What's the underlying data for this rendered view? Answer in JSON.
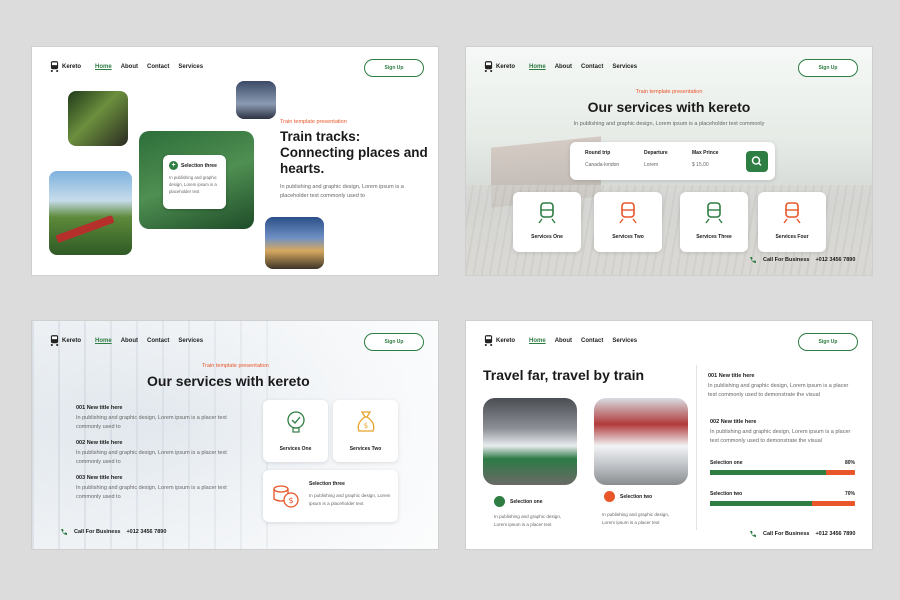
{
  "nav": {
    "logo": "Kereto",
    "links": [
      "Home",
      "About",
      "Contact",
      "Services"
    ],
    "signup": "Sign Up"
  },
  "colors": {
    "green": "#2e7d42",
    "orange": "#e8562a"
  },
  "slide1": {
    "eyebrow": "Train template presentation",
    "title": "Train tracks: Connecting places and hearts.",
    "body": "In publishing and graphic design, Lorem ipsum is a placeholder text commonly used to",
    "card_title": "Selection three",
    "card_body": "In publishing and graphic design, Lorem ipsum is a placeholder text"
  },
  "slide2": {
    "eyebrow": "Train template presentation",
    "title": "Our services with kereto",
    "sub": "In publishing and graphic design, Lorem ipsum is a placeholder text commonly",
    "search": {
      "f1_label": "Round trip",
      "f1_value": "Canada-london",
      "f2_label": "Departure",
      "f2_value": "Lorem",
      "f3_label": "Max Prince",
      "f3_value": "$ 15.00"
    },
    "services": [
      "Services One",
      "Services Two",
      "Services Three",
      "Services Four"
    ],
    "call_label": "Call For Business",
    "call_number": "+012 3456 7890"
  },
  "slide3": {
    "eyebrow": "Train template presentation",
    "title": "Our services with kereto",
    "items": [
      {
        "title": "001  New title here",
        "body": "In publishing and graphic design, Lorem ipsum is a placer text commonly used to"
      },
      {
        "title": "002  New title here",
        "body": "In publishing and graphic design, Lorem ipsum is a placer text commonly used to"
      },
      {
        "title": "003  New title here",
        "body": "In publishing and graphic design, Lorem ipsum is a placer text commonly used to"
      }
    ],
    "svc1": "Services One",
    "svc2": "Services Two",
    "sel_title": "Selection three",
    "sel_body": "In publishing and graphic design, Lorem ipsum is a placeholder text",
    "call_label": "Call For Business",
    "call_number": "+012 3456 7890"
  },
  "slide4": {
    "title": "Travel far, travel by train",
    "sel1_title": "Selection one",
    "sel1_body": "In publishing and graphic design, Lorem ipsum is a placer text",
    "sel2_title": "Selection two",
    "sel2_body": "In publishing and graphic design, Lorem ipsum is a placer text",
    "item1_title": "001  New title here",
    "item1_body": "In publishing and graphic design, Lorem ipsum is a placer text commonly used to demonstrate the visual",
    "item2_title": "002  New title here",
    "item2_body": "In publishing and graphic design, Lorem ipsum is a placer text commonly used to demonstrate the visual",
    "bars": [
      {
        "label": "Selection one",
        "value_text": "80%",
        "value": 0.8
      },
      {
        "label": "Selection two",
        "value_text": "70%",
        "value": 0.7
      }
    ],
    "call_label": "Call For Business",
    "call_number": "+012 3456 7890"
  }
}
